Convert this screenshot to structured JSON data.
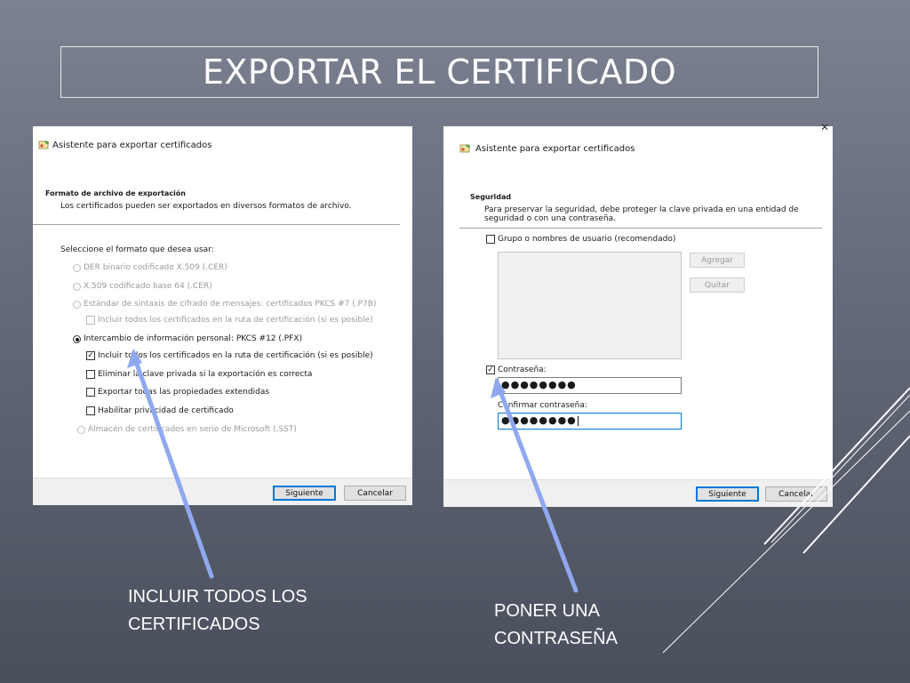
{
  "slide": {
    "title": "EXPORTAR EL CERTIFICADO"
  },
  "left_window": {
    "title": "Asistente para exportar certificados",
    "section_heading": "Formato de archivo de exportación",
    "section_desc": "Los certificados pueden ser exportados en diversos formatos de archivo.",
    "prompt": "Seleccione el formato que desea usar:",
    "options": [
      {
        "label": "DER binario codificado X.509 (.CER)",
        "selected": false,
        "enabled": false
      },
      {
        "label": "X.509 codificado base 64 (.CER)",
        "selected": false,
        "enabled": false
      },
      {
        "label": "Estándar de sintaxis de cifrado de mensajes: certificados PKCS #7 (.P7B)",
        "selected": false,
        "enabled": false
      },
      {
        "label": "Intercambio de información personal: PKCS #12 (.PFX)",
        "selected": true,
        "enabled": true
      },
      {
        "label": "Almacén de certificados en serie de Microsoft (.SST)",
        "selected": false,
        "enabled": false
      }
    ],
    "p7b_include_all": {
      "label": "Incluir todos los certificados en la ruta de certificación (si es posible)",
      "checked": false
    },
    "pfx_checks": [
      {
        "label": "Incluir todos los certificados en la ruta de certificación (si es posible)",
        "checked": true
      },
      {
        "label": "Eliminar la clave privada si la exportación es correcta",
        "checked": false
      },
      {
        "label": "Exportar todas las propiedades extendidas",
        "checked": false
      },
      {
        "label": "Habilitar privacidad de certificado",
        "checked": false
      }
    ],
    "next_label": "Siguiente",
    "cancel_label": "Cancelar"
  },
  "right_window": {
    "title": "Asistente para exportar certificados",
    "close_glyph": "✕",
    "section_heading": "Seguridad",
    "section_desc_1": "Para preservar la seguridad, debe proteger la clave privada en una entidad de",
    "section_desc_2": "seguridad o con una contraseña.",
    "group_option": {
      "label": "Grupo o nombres de usuario (recomendado)",
      "checked": false
    },
    "add_label": "Agregar",
    "remove_label": "Quitar",
    "password_option": {
      "label": "Contraseña:",
      "checked": true
    },
    "password_value": "●●●●●●●●",
    "confirm_label": "Confirmar contraseña:",
    "confirm_value": "●●●●●●●●",
    "next_label": "Siguiente",
    "cancel_label": "Cancelar"
  },
  "captions": {
    "left": [
      "INCLUIR TODOS LOS",
      "CERTIFICADOS"
    ],
    "right": [
      "PONER UNA",
      "CONTRASEÑA"
    ]
  },
  "colors": {
    "arrow": "#8fa8f0",
    "focus": "#0078d7",
    "decor_lines": "#ffffff"
  }
}
